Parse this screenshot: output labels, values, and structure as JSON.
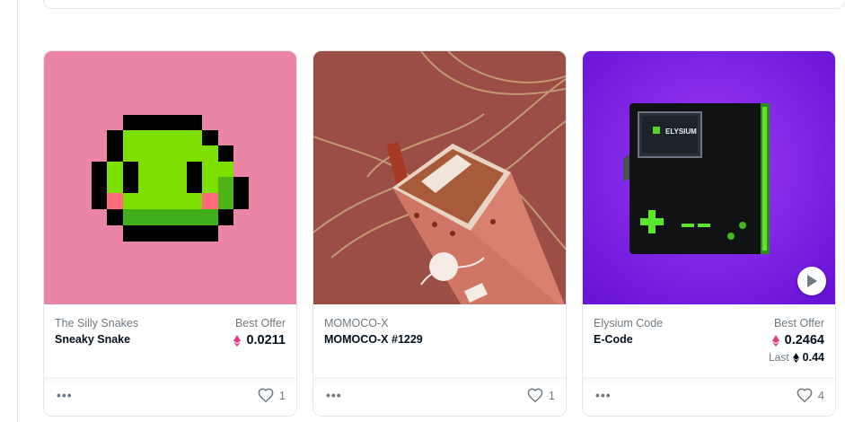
{
  "colors": {
    "pink_bg": "#ea85a6",
    "momoco_bg": "#9b4e45",
    "elysium_bg": "#7b1fe0",
    "eth_pink": "#e0407f",
    "text_primary": "#04111d",
    "text_secondary": "#707a83"
  },
  "cards": [
    {
      "collection": "The Silly Snakes",
      "name": "Sneaky Snake",
      "price_label": "Best Offer",
      "price": "0.0211",
      "currency_icon": "weth-icon",
      "likes": "1"
    },
    {
      "collection": "MOMOCO-X",
      "name": "MOMOCO-X #1229",
      "likes": "1"
    },
    {
      "collection": "Elysium Code",
      "name": "E-Code",
      "price_label": "Best Offer",
      "price": "0.2464",
      "currency_icon": "weth-icon",
      "last_label": "Last",
      "last_price": "0.44",
      "last_currency_icon": "eth-icon",
      "likes": "4",
      "elysium_text": "ELYSIUM"
    }
  ]
}
